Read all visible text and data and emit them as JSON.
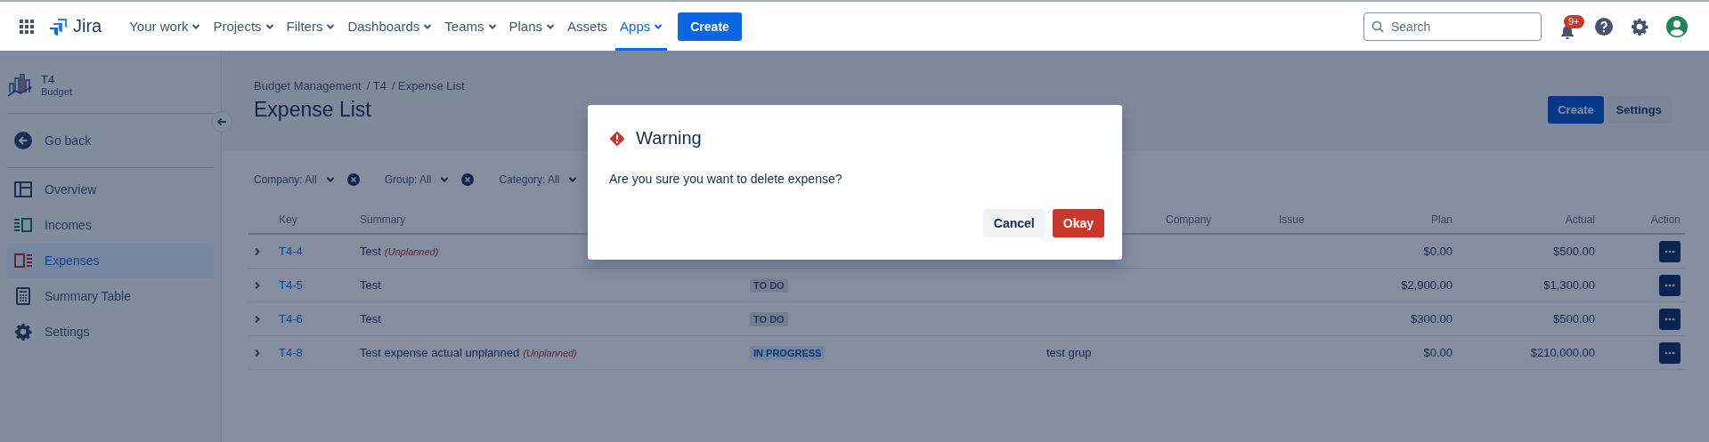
{
  "nav": {
    "product": "Jira",
    "items": [
      {
        "label": "Your work",
        "dropdown": true,
        "selected": false
      },
      {
        "label": "Projects",
        "dropdown": true,
        "selected": false
      },
      {
        "label": "Filters",
        "dropdown": true,
        "selected": false
      },
      {
        "label": "Dashboards",
        "dropdown": true,
        "selected": false
      },
      {
        "label": "Teams",
        "dropdown": true,
        "selected": false
      },
      {
        "label": "Plans",
        "dropdown": true,
        "selected": false
      },
      {
        "label": "Assets",
        "dropdown": false,
        "selected": false
      },
      {
        "label": "Apps",
        "dropdown": true,
        "selected": true
      }
    ],
    "create": "Create",
    "search": {
      "placeholder": "Search"
    },
    "notifications_badge": "9+"
  },
  "sidebar": {
    "project": {
      "name": "T4",
      "type": "Budget"
    },
    "back": "Go back",
    "items": [
      {
        "label": "Overview",
        "selected": false
      },
      {
        "label": "Incomes",
        "selected": false
      },
      {
        "label": "Expenses",
        "selected": true
      },
      {
        "label": "Summary Table",
        "selected": false
      },
      {
        "label": "Settings",
        "selected": false
      }
    ]
  },
  "page": {
    "breadcrumbs": [
      "Budget Management",
      "/ T4",
      "/ Expense List"
    ],
    "title": "Expense List",
    "actions": [
      "Create",
      "Settings"
    ]
  },
  "filters": [
    "Company: All",
    "Group: All",
    "Category: All"
  ],
  "table": {
    "columns": {
      "key": "Key",
      "summary": "Summary",
      "company": "Company",
      "issue": "Issue",
      "plan": "Plan",
      "actual": "Actual",
      "action": "Action"
    },
    "rows": [
      {
        "key": "T4-4",
        "summary": "Test",
        "tag": "(Unplanned)",
        "plan": "$0.00",
        "actual": "$500.00"
      },
      {
        "key": "T4-5",
        "summary": "Test",
        "status": {
          "label": "TO DO",
          "kind": "todo"
        },
        "plan": "$2,900.00",
        "actual": "$1,300.00"
      },
      {
        "key": "T4-6",
        "summary": "Test",
        "status": {
          "label": "TO DO",
          "kind": "todo"
        },
        "plan": "$300.00",
        "actual": "$500.00"
      },
      {
        "key": "T4-8",
        "summary": "Test expense actual unplanned",
        "tag": "(Unplanned)",
        "status": {
          "label": "IN PROGRESS",
          "kind": "inprogress"
        },
        "column_4": "test grup",
        "plan": "$0.00",
        "actual": "$210,000.00"
      }
    ]
  },
  "dialog": {
    "title": "Warning",
    "message": "Are you sure you want to delete expense?",
    "buttons": [
      {
        "label": "Cancel",
        "kind": "subtle"
      },
      {
        "label": "Okay",
        "kind": "danger"
      }
    ]
  }
}
